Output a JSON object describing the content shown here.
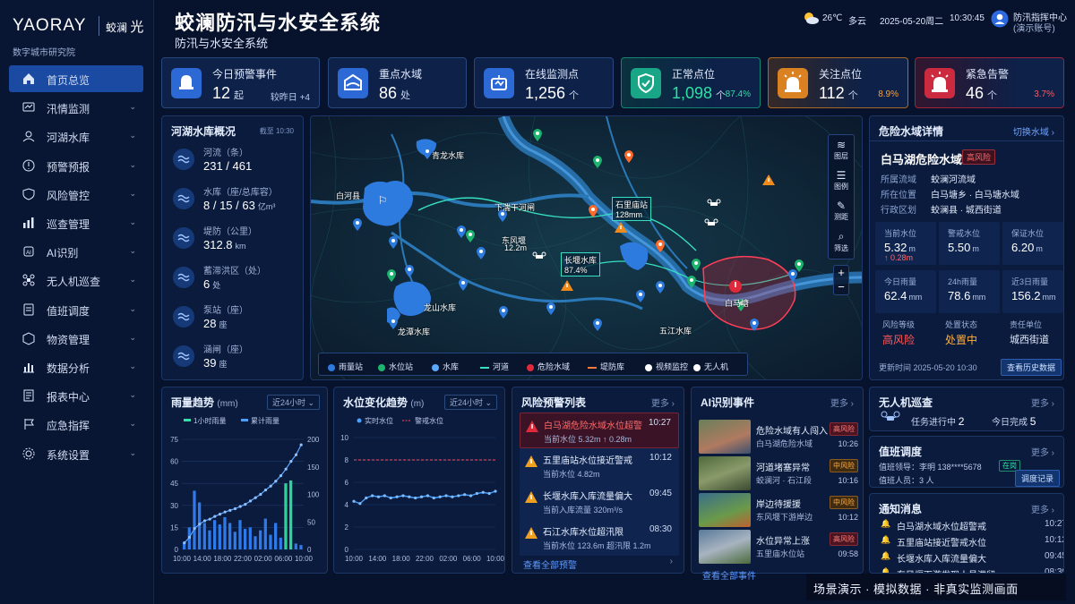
{
  "brand": {
    "logo": "YAORAY",
    "logo_sub": "蛟澜",
    "logo_sub2": "光",
    "org": "数字城市研究院"
  },
  "header": {
    "title": "蛟澜防汛与水安全系统",
    "subtitle": "防汛与水安全系统",
    "temp": "26℃",
    "weather": "多云",
    "date": "2025-05-20周二",
    "time": "10:30:45",
    "user": "防汛指挥中心",
    "user_sub": "(演示账号)"
  },
  "nav": [
    {
      "label": "首页总览",
      "icon": "home-icon"
    },
    {
      "label": "汛情监测",
      "icon": "monitor-icon"
    },
    {
      "label": "河湖水库",
      "icon": "reservoir-icon"
    },
    {
      "label": "预警预报",
      "icon": "alert-icon"
    },
    {
      "label": "风险管控",
      "icon": "shield-icon"
    },
    {
      "label": "巡查管理",
      "icon": "patrol-icon"
    },
    {
      "label": "AI识别",
      "icon": "ai-icon"
    },
    {
      "label": "无人机巡查",
      "icon": "drone-icon"
    },
    {
      "label": "值班调度",
      "icon": "duty-icon"
    },
    {
      "label": "物资管理",
      "icon": "box-icon"
    },
    {
      "label": "数据分析",
      "icon": "chart-icon"
    },
    {
      "label": "报表中心",
      "icon": "report-icon"
    },
    {
      "label": "应急指挥",
      "icon": "flag-icon"
    },
    {
      "label": "系统设置",
      "icon": "gear-icon"
    }
  ],
  "kpis": [
    {
      "label": "今日预警事件",
      "value": "12",
      "unit": "起",
      "extra": "较昨日 +4",
      "color": "#2f6fe0",
      "extra_color": "#bccbeb"
    },
    {
      "label": "重点水域",
      "value": "86",
      "unit": "处",
      "extra": "",
      "color": "#2f6fe0",
      "extra_color": "#bccbeb"
    },
    {
      "label": "在线监测点",
      "value": "1,256",
      "unit": "个",
      "extra": "",
      "color": "#2f6fe0",
      "extra_color": "#bccbeb"
    },
    {
      "label": "正常点位",
      "value": "1,098",
      "unit": "个",
      "extra": "87.4%",
      "color": "#19b38b",
      "extra_color": "#2fe2a4"
    },
    {
      "label": "关注点位",
      "value": "112",
      "unit": "个",
      "extra": "8.9%",
      "color": "#f08a1a",
      "extra_color": "#ffa23d"
    },
    {
      "label": "紧急告警",
      "value": "46",
      "unit": "个",
      "extra": "3.7%",
      "color": "#e0293a",
      "extra_color": "#ff5a64"
    }
  ],
  "overview": {
    "title": "河湖水库概况",
    "updated": "截至 10:30",
    "rows": [
      {
        "label": "河流（条）",
        "value": "231 / 461",
        "unit": ""
      },
      {
        "label": "水库（座/总库容）",
        "value": "8 / 15 / 63",
        "unit": "亿m³"
      },
      {
        "label": "堤防（公里）",
        "value": "312.8",
        "unit": "km"
      },
      {
        "label": "蓄滞洪区（处）",
        "value": "6",
        "unit": "处"
      },
      {
        "label": "泵站（座）",
        "value": "28",
        "unit": "座"
      },
      {
        "label": "涵闸（座）",
        "value": "39",
        "unit": "座"
      }
    ]
  },
  "map": {
    "labels": {
      "qinglong": "青龙水库",
      "baihe": "白河县",
      "xiazhi": "下湍干河闸",
      "dongfeng": "东风堰",
      "dongfeng_v": "12.2m",
      "shili": "石里庙站",
      "shili_v": "128mm",
      "changyan": "长堰水库",
      "changyan_v": "87.4%",
      "baima": "白马塘",
      "longshan": "龙山水库",
      "longtan": "龙潭水库",
      "wujiang": "五江水库"
    },
    "tools": [
      "图层",
      "图例",
      "测距",
      "筛选"
    ],
    "legend": [
      "雨量站",
      "水位站",
      "水库",
      "河道",
      "危险水域",
      "堤防库",
      "视频监控",
      "无人机"
    ]
  },
  "detail": {
    "title": "危险水域详情",
    "switch": "切换水域",
    "name": "白马湖危险水域",
    "risk_tag": "高风险",
    "basin_k": "所属流域",
    "basin_v": "蛟澜河流域",
    "loc_k": "所在位置",
    "loc_v": "白马塘乡 · 白马塘水域",
    "area_k": "行政区划",
    "area_v": "蛟澜县 · 城西街道",
    "cells": [
      {
        "label": "当前水位",
        "value": "5.32",
        "unit": "m",
        "delta": "↑ 0.28m"
      },
      {
        "label": "警戒水位",
        "value": "5.50",
        "unit": "m",
        "delta": ""
      },
      {
        "label": "保证水位",
        "value": "6.20",
        "unit": "m",
        "delta": ""
      },
      {
        "label": "今日雨量",
        "value": "62.4",
        "unit": "mm",
        "delta": ""
      },
      {
        "label": "24h雨量",
        "value": "78.6",
        "unit": "mm",
        "delta": ""
      },
      {
        "label": "近3日雨量",
        "value": "156.2",
        "unit": "mm",
        "delta": ""
      }
    ],
    "lvl_k": "风险等级",
    "lvl_v": "高风险",
    "status_k": "处置状态",
    "status_v": "处置中",
    "unit_k": "责任单位",
    "unit_v": "城西街道",
    "update_k": "更新时间",
    "update_v": "2025-05-20 10:30",
    "history_btn": "查看历史数据"
  },
  "drone": {
    "title": "无人机巡查",
    "more": "更多 ›",
    "task_k": "任务进行中",
    "task_v": "2",
    "done_k": "今日完成",
    "done_v": "5"
  },
  "duty": {
    "title": "值班调度",
    "more": "更多 ›",
    "leader": "值班领导：",
    "leader_name": "李明",
    "phone": "138****5678",
    "tag": "在岗",
    "persons": "值班人员：",
    "persons_v": "3 人",
    "btn": "调度记录"
  },
  "notices": {
    "title": "通知消息",
    "more": "更多 ›",
    "items": [
      {
        "text": "白马湖水域水位超警戒",
        "time": "10:27"
      },
      {
        "text": "五里庙站接近警戒水位",
        "time": "10:12"
      },
      {
        "text": "长堰水库入库流量偏大",
        "time": "09:45"
      },
      {
        "text": "东风堰下游发现人员滞留",
        "time": "08:30"
      }
    ]
  },
  "rain": {
    "title": "雨量趋势",
    "unit": "(mm)",
    "select": "近24小时",
    "legend1": "1小时雨量",
    "legend2": "累计雨量"
  },
  "water": {
    "title": "水位变化趋势",
    "unit": "(m)",
    "select": "近24小时",
    "legend1": "实时水位",
    "legend2": "警戒水位"
  },
  "risks": {
    "title": "风险预警列表",
    "more": "更多 ›",
    "footer": "查看全部预警",
    "items": [
      {
        "title": "白马湖危险水域水位超警",
        "desc": "当前水位 5.32m  ↑ 0.28m",
        "time": "10:27"
      },
      {
        "title": "五里庙站水位接近警戒",
        "desc": "当前水位 4.82m",
        "time": "10:12"
      },
      {
        "title": "长堰水库入库流量偏大",
        "desc": "当前入库流量 320m³/s",
        "time": "09:45"
      },
      {
        "title": "石江水库水位超汛限",
        "desc": "当前水位 123.6m   超汛限 1.2m",
        "time": "08:30"
      }
    ]
  },
  "ai": {
    "title": "AI识别事件",
    "more": "更多 ›",
    "footer": "查看全部事件",
    "items": [
      {
        "title": "危险水域有人闯入",
        "desc": "白马湖危险水域",
        "tag": "高风险",
        "time": "10:26"
      },
      {
        "title": "河道堵塞异常",
        "desc": "蛟澜河 · 石江段",
        "tag": "中风险",
        "time": "10:16"
      },
      {
        "title": "岸边待援援",
        "desc": "东风堰下游岸边",
        "tag": "中风险",
        "time": "10:12"
      },
      {
        "title": "水位异常上涨",
        "desc": "五里庙水位站",
        "tag": "高风险",
        "time": "09:58"
      }
    ]
  },
  "watermark": "场景演示 · 模拟数据 · 非真实监测画面",
  "chart_data": [
    {
      "type": "bar",
      "title": "雨量趋势",
      "ylabel": "(mm)",
      "categories": [
        "10:00",
        "11:00",
        "12:00",
        "13:00",
        "14:00",
        "15:00",
        "16:00",
        "17:00",
        "18:00",
        "19:00",
        "20:00",
        "21:00",
        "22:00",
        "23:00",
        "00:00",
        "01:00",
        "02:00",
        "03:00",
        "04:00",
        "05:00",
        "06:00",
        "07:00",
        "08:00",
        "09:00"
      ],
      "x_ticks": [
        "10:00",
        "14:00",
        "18:00",
        "22:00",
        "02:00",
        "06:00",
        "10:00"
      ],
      "ylim": [
        0,
        75
      ],
      "y2lim": [
        0,
        200
      ],
      "yticks": [
        0,
        15,
        30,
        45,
        60,
        75
      ],
      "y2ticks": [
        0,
        50,
        100,
        150,
        200
      ],
      "series": [
        {
          "name": "1小时雨量",
          "values": [
            5,
            15,
            40,
            32,
            18,
            13,
            20,
            17,
            22,
            18,
            12,
            20,
            14,
            15,
            9,
            13,
            21,
            10,
            18,
            8,
            45,
            47,
            4,
            3
          ]
        },
        {
          "name": "累计雨量",
          "values": [
            12,
            22,
            38,
            46,
            52,
            55,
            60,
            64,
            68,
            71,
            74,
            78,
            82,
            88,
            94,
            100,
            108,
            115,
            124,
            134,
            146,
            160,
            172,
            190
          ]
        }
      ]
    },
    {
      "type": "line",
      "title": "水位变化趋势",
      "ylabel": "(m)",
      "x_ticks": [
        "10:00",
        "14:00",
        "18:00",
        "22:00",
        "02:00",
        "06:00",
        "10:00"
      ],
      "ylim": [
        0,
        10
      ],
      "yticks": [
        0,
        2,
        4,
        6,
        8,
        10
      ],
      "series": [
        {
          "name": "实时水位",
          "values": [
            4.3,
            4.1,
            4.6,
            4.8,
            4.7,
            4.8,
            4.6,
            4.7,
            4.8,
            4.7,
            4.6,
            4.7,
            4.8,
            4.6,
            4.7,
            4.8,
            4.7,
            4.8,
            4.9,
            4.8,
            5.0,
            5.1,
            5.0,
            5.2
          ]
        },
        {
          "name": "警戒水位",
          "values": [
            8,
            8,
            8,
            8,
            8,
            8,
            8,
            8,
            8,
            8,
            8,
            8,
            8,
            8,
            8,
            8,
            8,
            8,
            8,
            8,
            8,
            8,
            8,
            8
          ]
        }
      ]
    }
  ]
}
